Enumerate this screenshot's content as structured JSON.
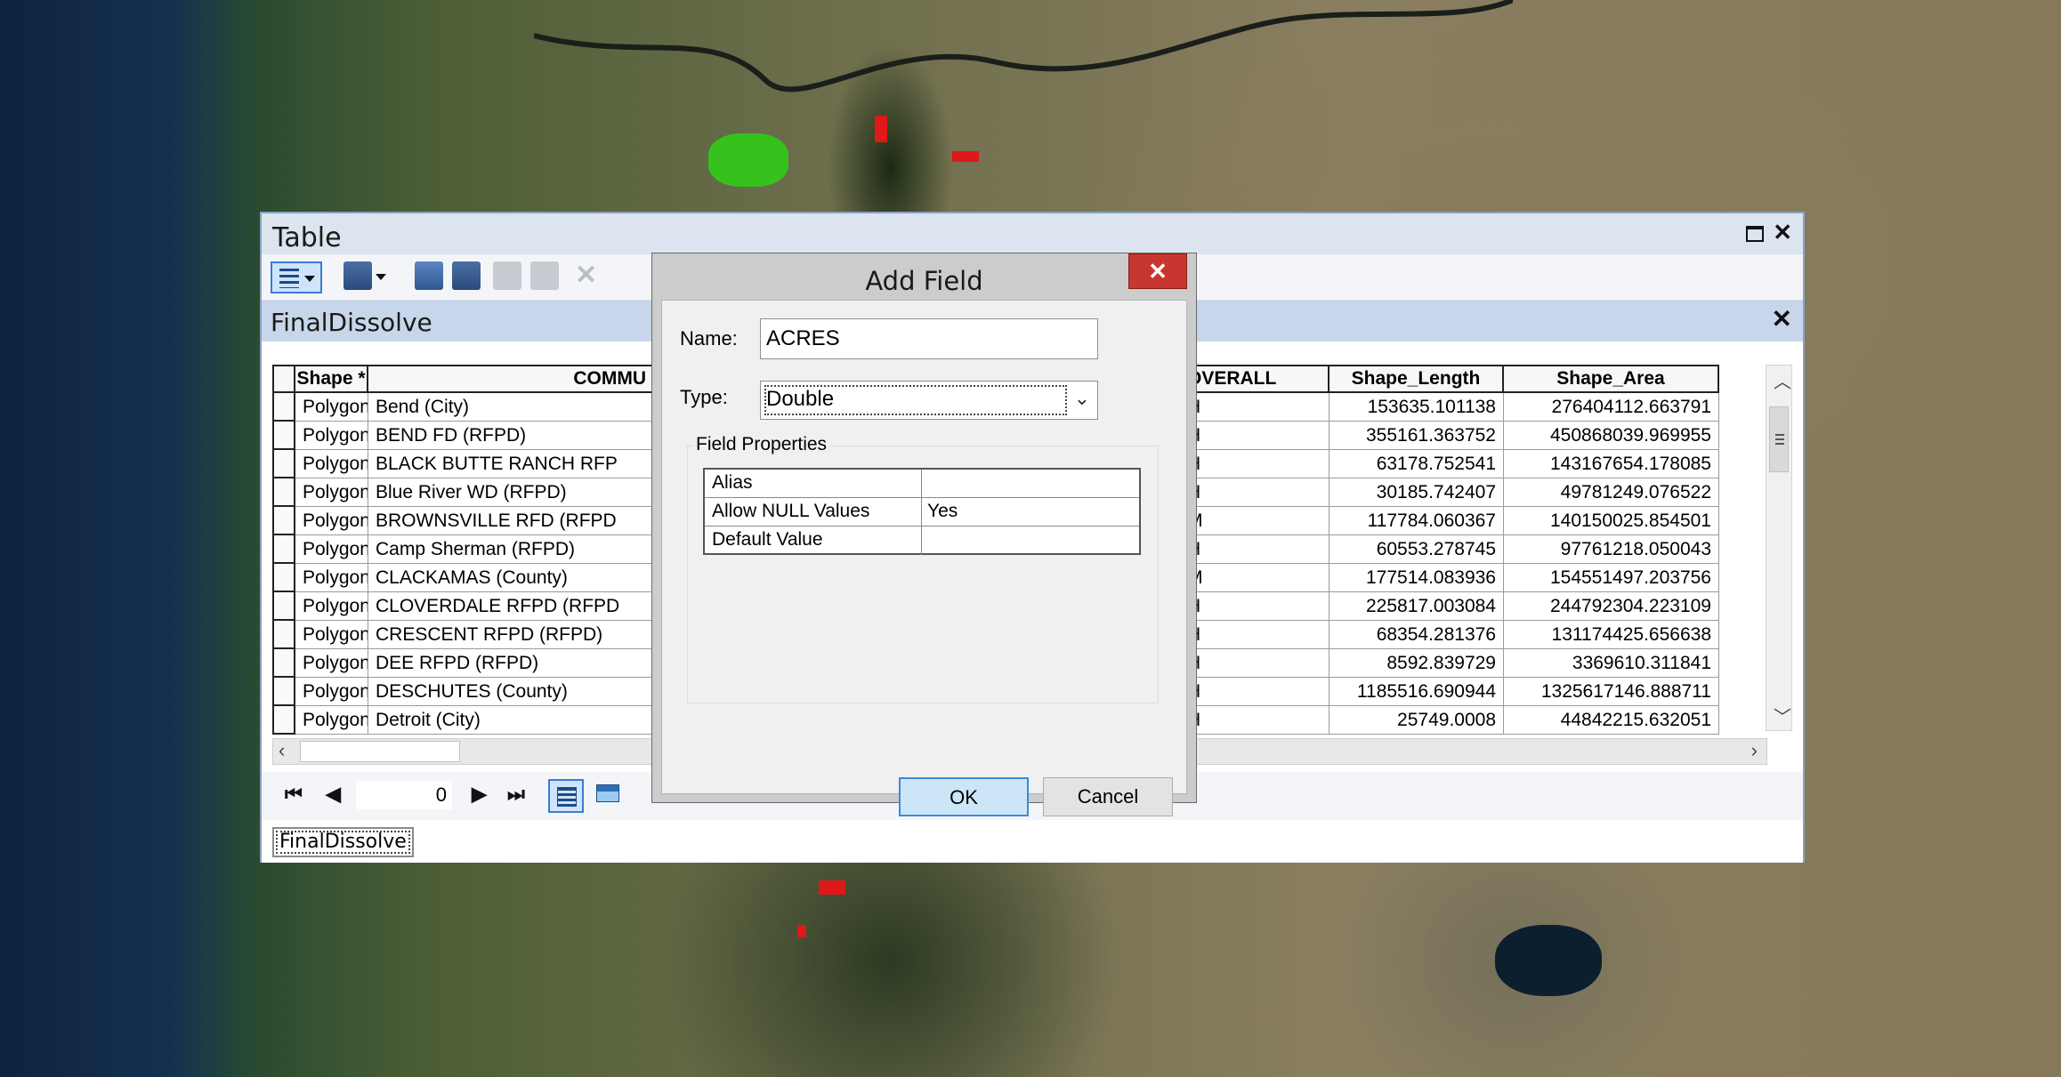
{
  "table_window": {
    "title": "Table",
    "layer_title": "FinalDissolve",
    "tab_label": "FinalDissolve",
    "record_position": "0",
    "columns": [
      "Shape *",
      "COMMU",
      "OVERALL",
      "Shape_Length",
      "Shape_Area"
    ],
    "rows": [
      {
        "shape": "Polygon",
        "commu": "Bend (City)",
        "overall": "H",
        "length": "153635.101138",
        "area": "276404112.663791"
      },
      {
        "shape": "Polygon",
        "commu": "BEND FD (RFPD)",
        "overall": "H",
        "length": "355161.363752",
        "area": "450868039.969955"
      },
      {
        "shape": "Polygon",
        "commu": "BLACK BUTTE RANCH RFP",
        "overall": "H",
        "length": "63178.752541",
        "area": "143167654.178085"
      },
      {
        "shape": "Polygon",
        "commu": "Blue River WD (RFPD)",
        "overall": "H",
        "length": "30185.742407",
        "area": "49781249.076522"
      },
      {
        "shape": "Polygon",
        "commu": "BROWNSVILLE RFD (RFPD",
        "overall": "M",
        "length": "117784.060367",
        "area": "140150025.854501"
      },
      {
        "shape": "Polygon",
        "commu": "Camp Sherman (RFPD)",
        "overall": "H",
        "length": "60553.278745",
        "area": "97761218.050043"
      },
      {
        "shape": "Polygon",
        "commu": "CLACKAMAS (County)",
        "overall": "M",
        "length": "177514.083936",
        "area": "154551497.203756"
      },
      {
        "shape": "Polygon",
        "commu": "CLOVERDALE RFPD (RFPD",
        "overall": "H",
        "length": "225817.003084",
        "area": "244792304.223109"
      },
      {
        "shape": "Polygon",
        "commu": "CRESCENT RFPD (RFPD)",
        "overall": "H",
        "length": "68354.281376",
        "area": "131174425.656638"
      },
      {
        "shape": "Polygon",
        "commu": "DEE RFPD (RFPD)",
        "overall": "H",
        "length": "8592.839729",
        "area": "3369610.311841"
      },
      {
        "shape": "Polygon",
        "commu": "DESCHUTES (County)",
        "overall": "H",
        "length": "1185516.690944",
        "area": "1325617146.888711"
      },
      {
        "shape": "Polygon",
        "commu": "Detroit (City)",
        "overall": "H",
        "length": "25749.0008",
        "area": "44842215.632051"
      }
    ]
  },
  "dialog": {
    "title": "Add Field",
    "close_label": "✕",
    "name_label": "Name:",
    "name_value": "ACRES",
    "type_label": "Type:",
    "type_value": "Double",
    "field_properties_label": "Field Properties",
    "properties": [
      {
        "key": "Alias",
        "value": ""
      },
      {
        "key": "Allow NULL Values",
        "value": "Yes"
      },
      {
        "key": "Default Value",
        "value": ""
      }
    ],
    "ok_label": "OK",
    "cancel_label": "Cancel"
  },
  "icons": {
    "window_maximize": "maximize-icon",
    "window_close": "close-icon",
    "first_record": "first-record-icon",
    "prev_record": "previous-record-icon",
    "next_record": "next-record-icon",
    "last_record": "last-record-icon"
  },
  "colors": {
    "ok_button": "#cce6f8",
    "dialog_close": "#c7372f",
    "title_bar": "#dbe4ef",
    "layer_bar": "#c7d6ea"
  }
}
